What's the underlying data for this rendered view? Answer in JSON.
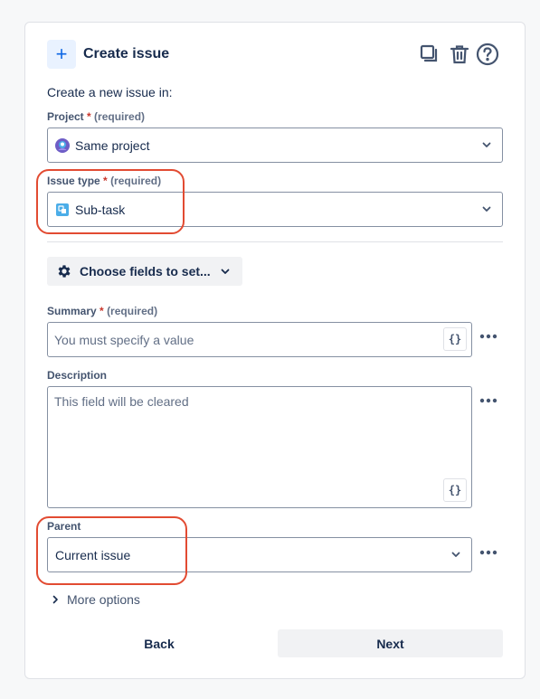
{
  "header": {
    "icon": "plus-icon",
    "title": "Create issue",
    "tools": [
      "copy-icon",
      "trash-icon",
      "help-icon"
    ]
  },
  "intro": "Create a new issue in:",
  "project": {
    "label": "Project",
    "required_star": "*",
    "required_text": "(required)",
    "value": "Same project",
    "icon": "project-avatar-icon"
  },
  "issue_type": {
    "label": "Issue type",
    "required_star": "*",
    "required_text": "(required)",
    "value": "Sub-task",
    "icon": "subtask-icon"
  },
  "choose_fields": {
    "label": "Choose fields to set...",
    "icon": "gear-icon"
  },
  "summary": {
    "label": "Summary",
    "required_star": "*",
    "required_text": "(required)",
    "placeholder": "You must specify a value",
    "brace": "{}"
  },
  "description": {
    "label": "Description",
    "placeholder": "This field will be cleared",
    "brace": "{}"
  },
  "parent": {
    "label": "Parent",
    "value": "Current issue"
  },
  "more_options": "More options",
  "footer": {
    "back": "Back",
    "next": "Next"
  },
  "colors": {
    "accent": "#0c66e4",
    "required": "#c9372c",
    "highlight": "#e24b32",
    "subtask": "#4bade8"
  }
}
